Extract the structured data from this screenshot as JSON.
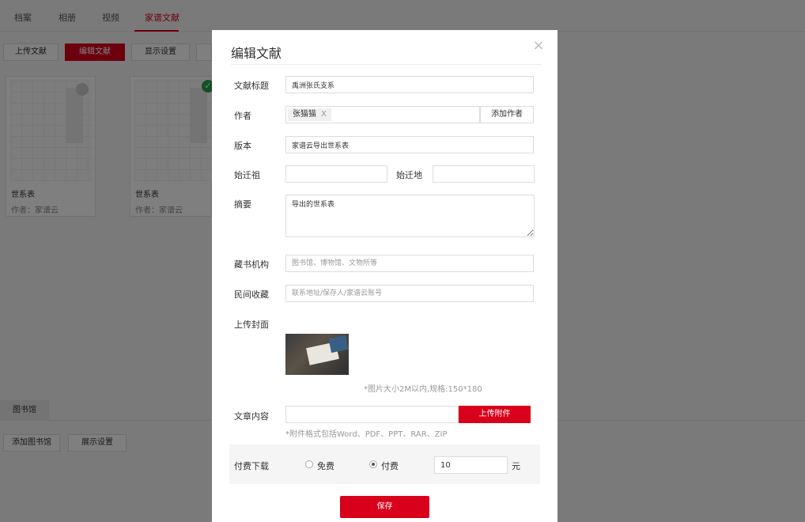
{
  "background": {
    "tabs": [
      {
        "label": "档案"
      },
      {
        "label": "相册"
      },
      {
        "label": "视频"
      },
      {
        "label": "家谱文献"
      }
    ],
    "toolbar": {
      "upload_label": "上传文献",
      "edit_label": "编辑文献",
      "display_label": "显示设置"
    },
    "cards": [
      {
        "title": "世系表",
        "author": "作者：家谱云"
      },
      {
        "title": "世系表",
        "author": "作者：家谱云"
      }
    ],
    "library": {
      "tab_label": "图书馆",
      "add_label": "添加图书馆",
      "display_label": "展示设置"
    }
  },
  "modal": {
    "title": "编辑文献",
    "close_glyph": "×",
    "fields": {
      "title_label": "文献标题",
      "title_value": "禹洲张氏支系",
      "author_label": "作者",
      "author_tag": "张猫猫",
      "author_tag_remove": "X",
      "add_author_label": "添加作者",
      "edition_label": "版本",
      "edition_value": "家谱云导出世系表",
      "ancestor_label": "始迁祖",
      "ancestor_value": "",
      "origin_label": "始迁地",
      "origin_value": "",
      "summary_label": "摘要",
      "summary_value": "导出的世系表",
      "institution_label": "藏书机构",
      "institution_placeholder": "图书馆、博物馆、文物所等",
      "private_label": "民间收藏",
      "private_placeholder": "联系地址/保存人/家谱云账号",
      "cover_label": "上传封面",
      "cover_hint": "*图片大小2M以内,规格:150*180",
      "content_label": "文章内容",
      "upload_attachment_label": "上传附件",
      "attachment_hint": "*附件格式包括Word、PDF、PPT、RAR、ZIP"
    },
    "payment": {
      "label": "付费下载",
      "free_label": "免费",
      "paid_label": "付费",
      "selected": "paid",
      "price_value": "10",
      "unit": "元"
    },
    "save_label": "保存"
  },
  "colors": {
    "accent": "#d9001b",
    "overlay": "rgba(0,0,0,0.5)"
  }
}
